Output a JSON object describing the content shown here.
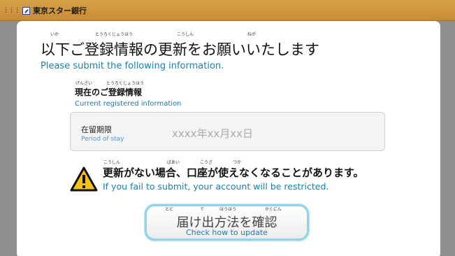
{
  "header": {
    "brand_name": "東京スター銀行"
  },
  "main": {
    "title": "以下ご登録情報の更新をお願いいたします",
    "title_furigana": [
      "いか",
      "とうろくじょうほう",
      "こうしん",
      "ねが"
    ],
    "title_en": "Please submit the following information.",
    "section_label": "現在のご登録情報",
    "section_furigana": [
      "げんざい",
      "とうろくじょうほう"
    ],
    "section_label_en": "Current registered information",
    "info": {
      "label": "在留期限",
      "label_en": "Period of stay",
      "value": "xxxx年xx月xx日"
    },
    "warning": {
      "text": "更新がない場合、口座が使えなくなることがあります。",
      "furigana": [
        "こうしん",
        "ばあい",
        "こうざ",
        "つか"
      ],
      "text_en": "If you fail to submit, your account will be restricted."
    },
    "cta": {
      "label": "届け出方法を確認",
      "furigana": [
        "とど",
        "で",
        "ほうほう",
        "かくにん"
      ],
      "label_en": "Check how to update"
    }
  }
}
